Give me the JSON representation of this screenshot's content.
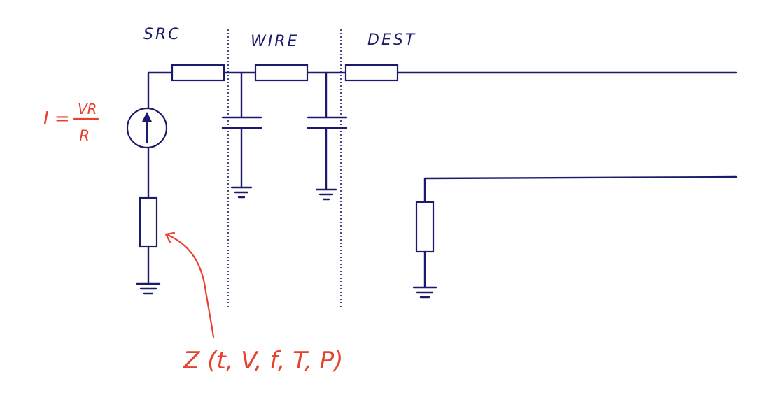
{
  "sections": {
    "src": "SRC",
    "wire": "WIRE",
    "dest": "DEST"
  },
  "formula": {
    "lhs": "I =",
    "numerator": "VR",
    "denominator": "R"
  },
  "impedance_label": "Z (t, V, f, T, P)",
  "colors": {
    "circuit": "#1b1b6e",
    "annotation": "#e8402f"
  }
}
